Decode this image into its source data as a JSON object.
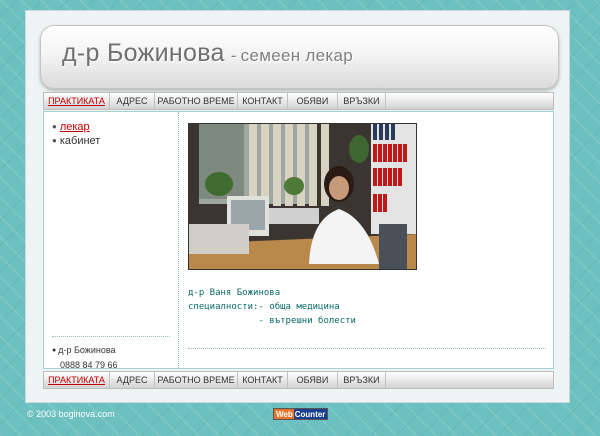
{
  "header": {
    "title": "д-р Божинова",
    "dash": "-",
    "subtitle": "семеен лекар"
  },
  "nav": {
    "items": [
      {
        "label": "ПРАКТИКАТА",
        "active": true
      },
      {
        "label": "АДРЕС"
      },
      {
        "label": "РАБОТНО ВРЕМЕ"
      },
      {
        "label": "КОНТАКТ"
      },
      {
        "label": "ОБЯВИ"
      },
      {
        "label": "ВРЪЗКИ"
      }
    ]
  },
  "sidebar": {
    "items": [
      {
        "label": "лекар",
        "active": true
      },
      {
        "label": "кабинет"
      }
    ],
    "contact_name": "д-р Божинова",
    "contact_phone": "0888 84 79 66"
  },
  "main": {
    "line1": "д-р Ваня Божинова",
    "line2": "специалности:- обща медицина",
    "line3": "             - вътрешни болести"
  },
  "footer": {
    "copyright": "© 2003 boginova.com",
    "counter_web": "Web",
    "counter_counter": "Counter"
  },
  "colors": {
    "background": "#6cc0c0",
    "accent_red": "#c00000",
    "teal_text": "#0a6a6a"
  }
}
